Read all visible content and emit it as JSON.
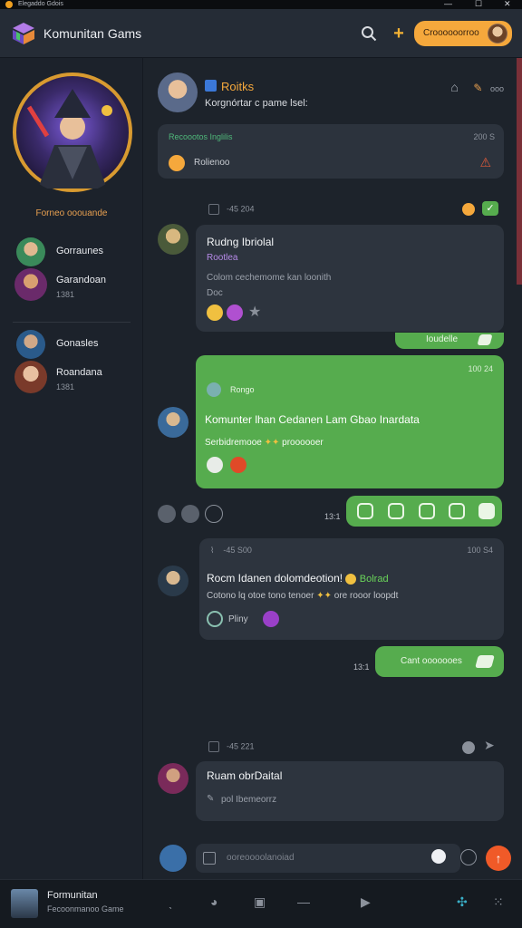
{
  "os": {
    "title": "Elegaddo Gdois"
  },
  "header": {
    "app_title": "Komunitan Gams",
    "action_label": "Croooooorroo"
  },
  "sidebar": {
    "hero_caption": "Forneo ooouande",
    "items": [
      {
        "name": "Gorraunes",
        "sub": ""
      },
      {
        "name": "Garandoan",
        "sub": "1381"
      },
      {
        "name": "Gonasles",
        "sub": ""
      },
      {
        "name": "Roandana",
        "sub": "1381"
      }
    ]
  },
  "room": {
    "name": "Roitks",
    "subtitle": "Korgnórtar c pame lsel:",
    "actions_label": "ooo"
  },
  "pinned": {
    "heading": "Recoootos Inglilis",
    "time": "200 S",
    "text": "Rolienoo"
  },
  "messages": [
    {
      "meta": "-45 204",
      "title": "Rudng Ibriolal",
      "tag": "Rootlea",
      "line1": "Colom cechemome kan loonith",
      "line2": "Doc",
      "reply_pill": "Ioudelle"
    },
    {
      "time": "100 24",
      "tag": "Rongo",
      "title": "Komunter lhan Cedanen Lam Gbao Inardata",
      "line1": "Serbidremooe",
      "line1b": "proooooer"
    },
    {
      "strip_time": "13:1"
    },
    {
      "meta": "-45 S00",
      "time": "100 S4",
      "title": "Rocm Idanen dolomdeotion!",
      "title_tag": "Bolrad",
      "line1": "Cotono lq otoe tono tenoer",
      "line1b": "ore rooor loopdt",
      "line2": "Pliny",
      "reply_pill": "Cant ooooooes",
      "reply_time": "13:1"
    },
    {
      "meta": "-45 221",
      "title": "Ruam obrDaital",
      "line1": "pol Ibemeorrz"
    }
  ],
  "composer": {
    "placeholder": "ooreoooolanoiad"
  },
  "user": {
    "name": "Formunitan",
    "sub": "Fecoonmanoo Game"
  },
  "colors": {
    "accent": "#f5a83c",
    "green": "#56ac4e",
    "send": "#f05a28"
  }
}
